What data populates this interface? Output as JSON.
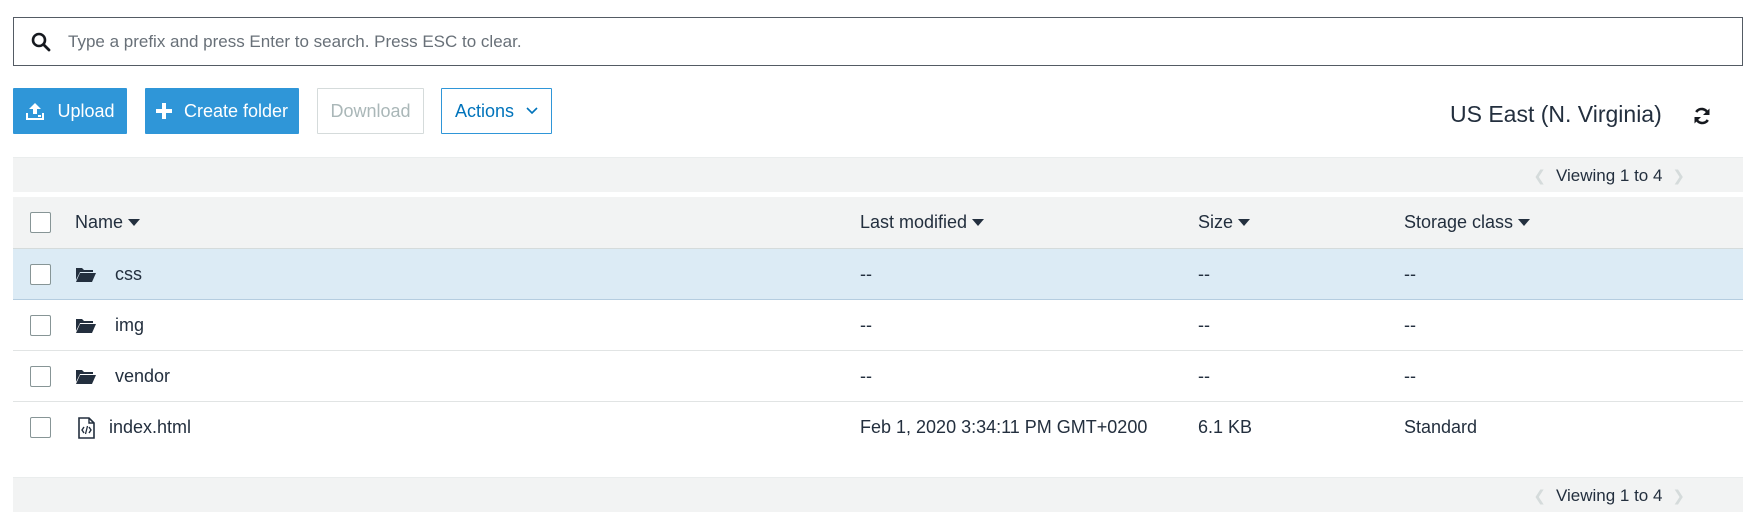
{
  "search": {
    "placeholder": "Type a prefix and press Enter to search. Press ESC to clear.",
    "value": "",
    "icon": "search-icon"
  },
  "toolbar": {
    "upload_label": "Upload",
    "create_folder_label": "Create folder",
    "download_label": "Download",
    "actions_label": "Actions",
    "region_label": "US East (N. Virginia)"
  },
  "pager": {
    "label": "Viewing 1 to 4"
  },
  "table": {
    "headers": {
      "name": "Name",
      "last_modified": "Last modified",
      "size": "Size",
      "storage_class": "Storage class"
    },
    "rows": [
      {
        "name": "css",
        "type": "folder",
        "last_modified": "--",
        "size": "--",
        "storage_class": "--",
        "selected": true
      },
      {
        "name": "img",
        "type": "folder",
        "last_modified": "--",
        "size": "--",
        "storage_class": "--",
        "selected": false
      },
      {
        "name": "vendor",
        "type": "folder",
        "last_modified": "--",
        "size": "--",
        "storage_class": "--",
        "selected": false
      },
      {
        "name": "index.html",
        "type": "file",
        "last_modified": "Feb 1, 2020 3:34:11 PM GMT+0200",
        "size": "6.1 KB",
        "storage_class": "Standard",
        "selected": false
      }
    ]
  },
  "colors": {
    "primary": "#2f96d8",
    "selected_row": "#dcebf5",
    "header_bg": "#f2f3f3",
    "text": "#232f3e"
  }
}
